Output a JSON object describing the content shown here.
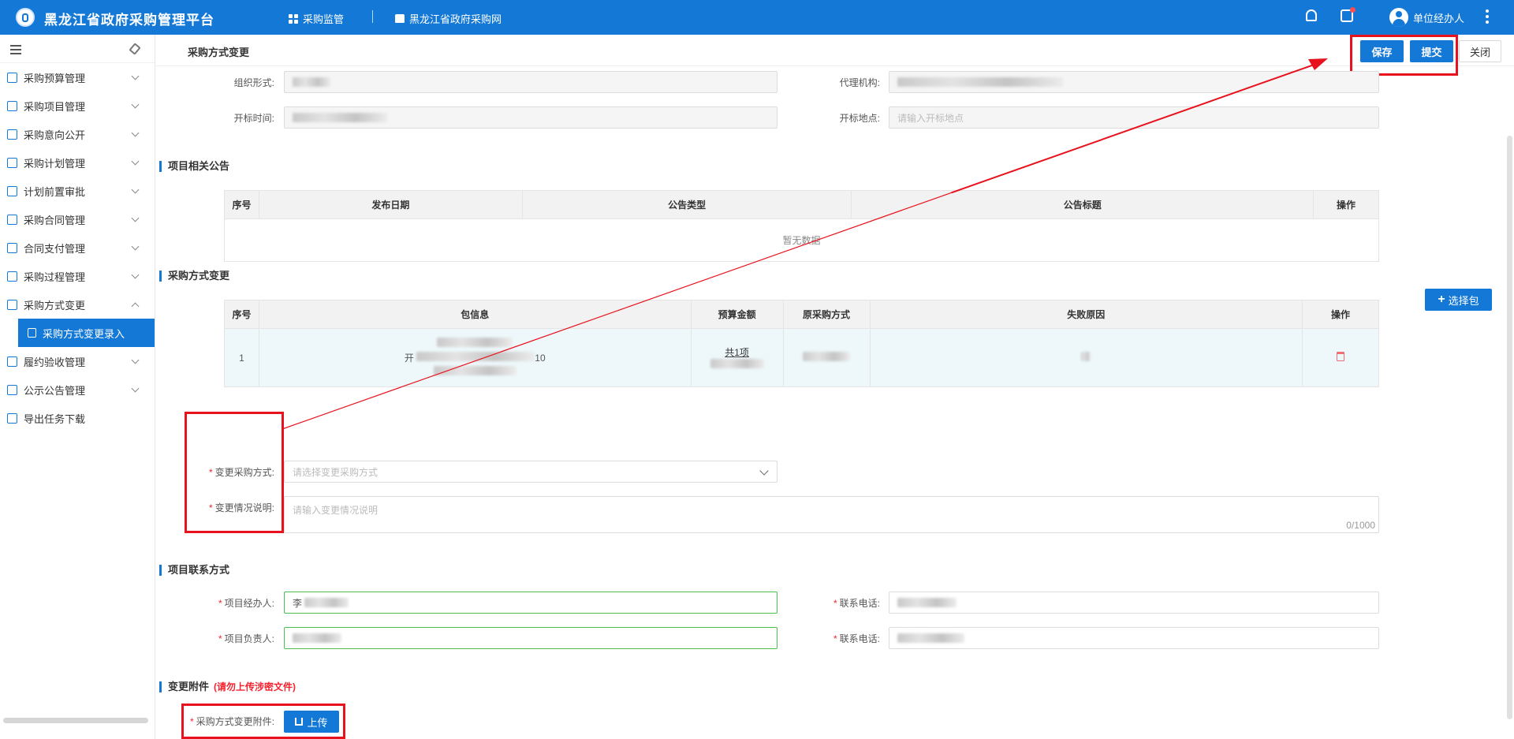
{
  "topbar": {
    "title": "黑龙江省政府采购管理平台",
    "nav": [
      {
        "label": "采购监管",
        "icon": "grid-icon"
      },
      {
        "label": "黑龙江省政府采购网",
        "icon": "home-icon"
      }
    ],
    "user": "单位经办人",
    "colors": {
      "primary": "#1478d6",
      "badge": "#ff4d4f"
    }
  },
  "sidebar": {
    "items": [
      {
        "label": "采购预算管理",
        "icon": "chart-icon"
      },
      {
        "label": "采购项目管理",
        "icon": "folder-icon"
      },
      {
        "label": "采购意向公开",
        "icon": "document-icon"
      },
      {
        "label": "采购计划管理",
        "icon": "checklist-icon"
      },
      {
        "label": "计划前置审批",
        "icon": "stamp-icon"
      },
      {
        "label": "采购合同管理",
        "icon": "contract-icon"
      },
      {
        "label": "合同支付管理",
        "icon": "payment-icon"
      },
      {
        "label": "采购过程管理",
        "icon": "process-icon"
      },
      {
        "label": "采购方式变更",
        "icon": "change-icon"
      },
      {
        "label": "采购方式变更录入",
        "icon": "form-icon"
      },
      {
        "label": "履约验收管理",
        "icon": "check-icon"
      },
      {
        "label": "公示公告管理",
        "icon": "announce-icon"
      },
      {
        "label": "导出任务下载",
        "icon": "export-icon"
      }
    ]
  },
  "page": {
    "title": "采购方式变更",
    "buttons": {
      "save": "保存",
      "submit": "提交",
      "close": "关闭"
    }
  },
  "form": {
    "org_label": "组织形式:",
    "agency_label": "代理机构:",
    "open_time_label": "开标时间:",
    "open_place_label": "开标地点:",
    "open_place_placeholder": "请输入开标地点"
  },
  "notices": {
    "title": "项目相关公告",
    "columns": [
      "序号",
      "发布日期",
      "公告类型",
      "公告标题",
      "操作"
    ],
    "empty": "暂无数据"
  },
  "change": {
    "title": "采购方式变更",
    "select_button": "选择包",
    "columns": [
      "序号",
      "包信息",
      "预算金额",
      "原采购方式",
      "失败原因",
      "操作"
    ],
    "rows": [
      {
        "index": "1",
        "package_prefix": "开",
        "package_suffix": "10",
        "budget": "共1项"
      }
    ],
    "method_label": "变更采购方式:",
    "method_placeholder": "请选择变更采购方式",
    "desc_label": "变更情况说明:",
    "desc_placeholder": "请输入变更情况说明",
    "desc_count": "0/1000"
  },
  "contact": {
    "title": "项目联系方式",
    "handler_label": "项目经办人:",
    "manager_label": "项目负责人:",
    "phone_label": "联系电话:",
    "handler_value": "李"
  },
  "attachment": {
    "title": "变更附件",
    "warning": "(请勿上传涉密文件)",
    "label": "采购方式变更附件:",
    "upload": "上传"
  }
}
